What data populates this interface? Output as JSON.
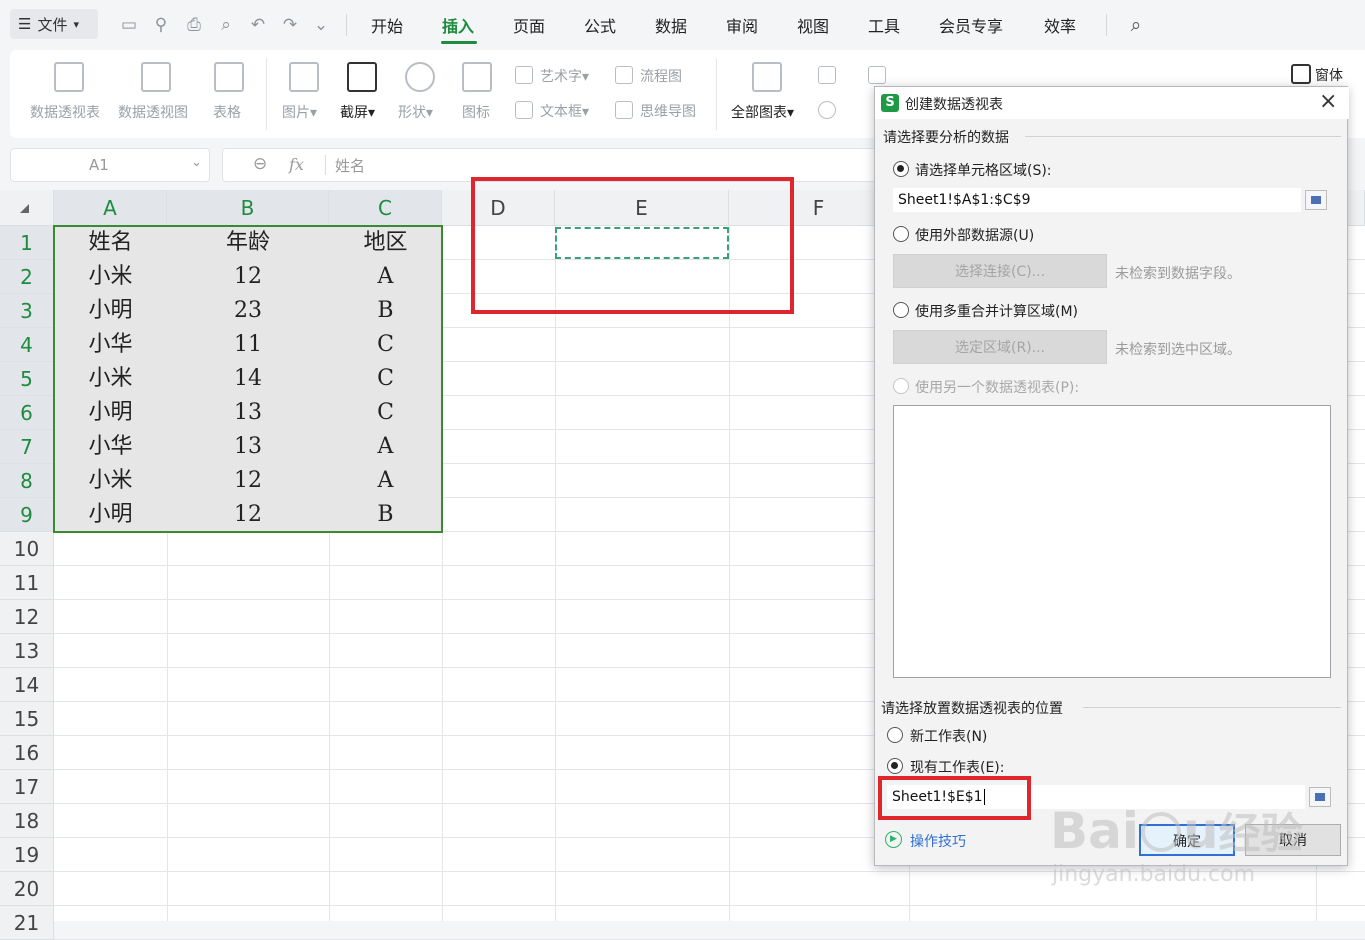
{
  "menu": {
    "file": "文件",
    "tabs": [
      "开始",
      "插入",
      "页面",
      "公式",
      "数据",
      "审阅",
      "视图",
      "工具",
      "会员专享",
      "效率"
    ],
    "active_tab": "插入"
  },
  "ribbon": {
    "pivot_table": "数据透视表",
    "pivot_chart": "数据透视图",
    "table": "表格",
    "picture": "图片",
    "screenshot": "截屏",
    "shape": "形状",
    "icon": "图标",
    "wordart": "艺术字",
    "textbox": "文本框",
    "flowchart": "流程图",
    "mindmap": "思维导图",
    "all_charts": "全部图表",
    "window": "窗体"
  },
  "formula_bar": {
    "cell_ref": "A1",
    "fx": "fx",
    "content": "姓名"
  },
  "sheet": {
    "columns": [
      "A",
      "B",
      "C",
      "D",
      "E",
      "F"
    ],
    "rows": [
      "1",
      "2",
      "3",
      "4",
      "5",
      "6",
      "7",
      "8",
      "9",
      "10",
      "11",
      "12",
      "13",
      "14",
      "15",
      "16",
      "17",
      "18",
      "19",
      "20",
      "21"
    ],
    "data": [
      [
        "姓名",
        "年龄",
        "地区"
      ],
      [
        "小米",
        "12",
        "A"
      ],
      [
        "小明",
        "23",
        "B"
      ],
      [
        "小华",
        "11",
        "C"
      ],
      [
        "小米",
        "14",
        "C"
      ],
      [
        "小明",
        "13",
        "C"
      ],
      [
        "小华",
        "13",
        "A"
      ],
      [
        "小米",
        "12",
        "A"
      ],
      [
        "小明",
        "12",
        "B"
      ]
    ]
  },
  "dialog": {
    "title": "创建数据透视表",
    "section_source": "请选择要分析的数据",
    "opt_range": "请选择单元格区域(S):",
    "range_value": "Sheet1!$A$1:$C$9",
    "opt_external": "使用外部数据源(U)",
    "btn_select_conn": "选择连接(C)...",
    "no_fields": "未检索到数据字段。",
    "opt_multi": "使用多重合并计算区域(M)",
    "btn_select_region": "选定区域(R)...",
    "no_region": "未检索到选中区域。",
    "opt_other_pivot": "使用另一个数据透视表(P):",
    "section_place": "请选择放置数据透视表的位置",
    "opt_new_sheet": "新工作表(N)",
    "opt_existing": "现有工作表(E):",
    "existing_value": "Sheet1!$E$1",
    "tips": "操作技巧",
    "ok": "确定",
    "cancel": "取消"
  },
  "watermark": {
    "brand": "Bai",
    "brand2": "经验",
    "url": "jingyan.baidu.com"
  }
}
